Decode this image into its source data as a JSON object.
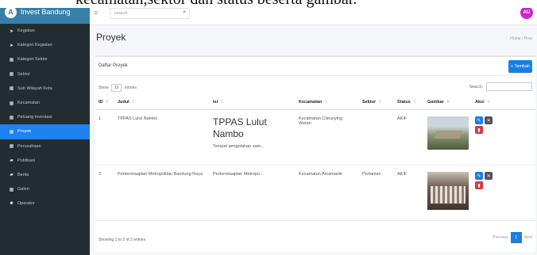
{
  "caption_fragment": "kecamatan,sektor dan status beserta gambar.",
  "brand": {
    "logo_letter": "A",
    "name": "Invest Bandung"
  },
  "topbar": {
    "search_placeholder": "search",
    "avatar_initials": "AU"
  },
  "sidebar": {
    "items": [
      {
        "label": "Kegiatan",
        "icon": "location-arrow-icon",
        "active": false
      },
      {
        "label": "Kategori Kegiatan",
        "icon": "location-arrow-icon",
        "active": false
      },
      {
        "label": "Kategori Sektor",
        "icon": "grid-icon",
        "active": false
      },
      {
        "label": "Sektor",
        "icon": "grid-icon",
        "active": false
      },
      {
        "label": "Sub Wilayah Kota",
        "icon": "grid-icon",
        "active": false
      },
      {
        "label": "Kecamatan",
        "icon": "grid-icon",
        "active": false
      },
      {
        "label": "Peluang Investasi",
        "icon": "grid-icon",
        "active": false
      },
      {
        "label": "Proyek",
        "icon": "grid-icon",
        "active": true
      },
      {
        "label": "Perusahaan",
        "icon": "grid-icon",
        "active": false
      },
      {
        "label": "Publikasi",
        "icon": "folder-icon",
        "active": false
      },
      {
        "label": "Berita",
        "icon": "folder-icon",
        "active": false
      },
      {
        "label": "Galeri",
        "icon": "grid-icon",
        "active": false
      },
      {
        "label": "Operator",
        "icon": "users-icon",
        "active": false
      }
    ]
  },
  "page": {
    "title": "Proyek",
    "breadcrumb": "Home / Proy"
  },
  "card": {
    "title": "Daftar Proyek",
    "add_button": "+ Tambah"
  },
  "table_controls": {
    "show_label": "Show",
    "show_value": "10",
    "entries_label": "entries",
    "search_label": "Search:"
  },
  "table": {
    "headers": [
      "ID",
      "Judul",
      "Isi",
      "Kecamatan",
      "Sektor",
      "Status",
      "Gambar",
      "Aksi"
    ],
    "rows": [
      {
        "id": "1",
        "judul": "TPPAS Lulut Nambo",
        "isi_title": "TPPAS Lulut Nambo",
        "isi_excerpt": "Tempat pengolahan sam...",
        "kecamatan": "Kecamatan Cileunying Wetan",
        "sektor": "",
        "status": "AKIF"
      },
      {
        "id": "2",
        "judul": "Perkeretaapian Metropolitan Bandung Raya",
        "isi_title": "",
        "isi_excerpt": "Perkeretaapian Metropo...",
        "kecamatan": "Kecamatan Arcamanik",
        "sektor": "Pertanian",
        "status": "AKIF"
      }
    ]
  },
  "footer": {
    "info": "Showing 1 to 2 of 2 entries",
    "previous": "Previous",
    "page": "1",
    "next": "Next"
  },
  "colors": {
    "sidebar_bg": "#222d32",
    "brand_bg": "#367fa9",
    "active_item": "#1e82f0",
    "primary": "#1a7fe0",
    "danger": "#dc3545",
    "avatar": "#c829c8"
  }
}
